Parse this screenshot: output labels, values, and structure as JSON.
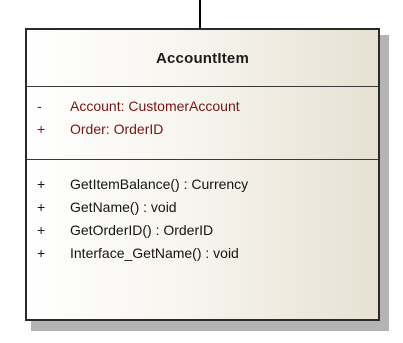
{
  "diagram": {
    "class_name": "AccountItem",
    "attributes": [
      {
        "visibility": "-",
        "signature": "Account:  CustomerAccount"
      },
      {
        "visibility": "+",
        "signature": "Order:  OrderID"
      }
    ],
    "operations": [
      {
        "visibility": "+",
        "signature": "GetItemBalance() : Currency"
      },
      {
        "visibility": "+",
        "signature": "GetName() : void"
      },
      {
        "visibility": "+",
        "signature": "GetOrderID() : OrderID"
      },
      {
        "visibility": "+",
        "signature": "Interface_GetName() : void"
      }
    ],
    "colors": {
      "attribute_text": "#7a1414",
      "operation_text": "#141414",
      "border": "#2a2a2a",
      "fill_gradient_end": "#e7e1d3"
    }
  }
}
